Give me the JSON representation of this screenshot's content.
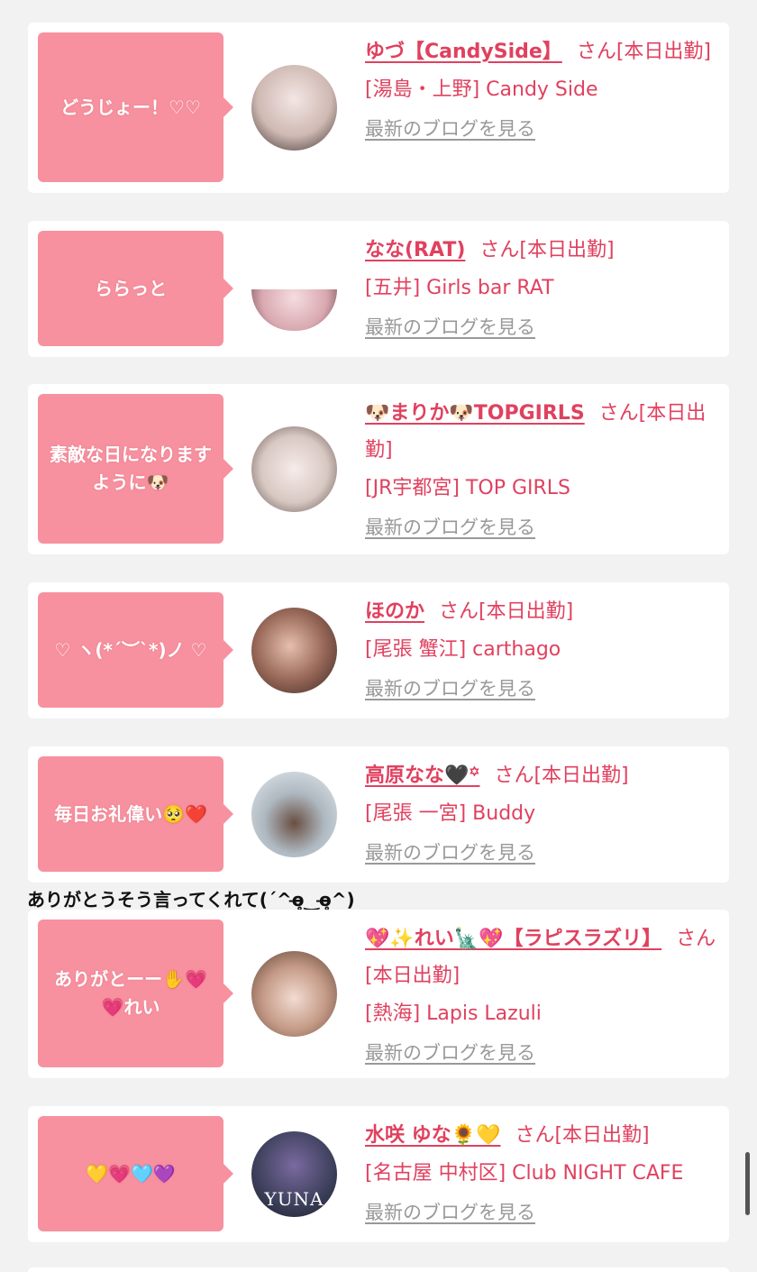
{
  "cards": [
    {
      "bubble": "どうじょー！♡♡",
      "name": "ゆづ【CandySide】",
      "suffix": "さん[本日出勤]",
      "shop": "[湯島・上野] Candy Side",
      "blog": "最新のブログを見る",
      "avatar_color": "#d9c9c4"
    },
    {
      "bubble": "ららっと",
      "name": "なな(RAT)",
      "suffix": "さん[本日出勤]",
      "shop": "[五井] Girls bar RAT",
      "blog": "最新のブログを見る",
      "avatar_color": "#e9c9cc"
    },
    {
      "bubble": "素敵な日になりますように🐶",
      "name": "🐶まりか🐶TOPGIRLS",
      "suffix": "さん[本日出勤]",
      "shop": "[JR宇都宮] TOP GIRLS",
      "blog": "最新のブログを見る",
      "avatar_color": "#e8ddd8"
    },
    {
      "bubble": "♡ ヽ(*´︶`*)ノ ♡",
      "name": "ほのか",
      "suffix": "さん[本日出勤]",
      "shop": "[尾張 蟹江] carthago",
      "blog": "最新のブログを見る",
      "avatar_color": "#8a5a4e"
    },
    {
      "bubble": "毎日お礼偉い🥺❤️",
      "name": "高原なな🖤꙳",
      "suffix": "さん[本日出勤]",
      "shop": "[尾張 一宮] Buddy",
      "blog": "最新のブログを見る",
      "avatar_color": "#b8c4cc"
    },
    {
      "bubble": "ありがとーー✋💗💗れい",
      "name": "💖✨れい🗽💖【ラピスラズリ】",
      "suffix": "さん[本日出勤]",
      "shop": "[熱海] Lapis Lazuli",
      "blog": "最新のブログを見る",
      "avatar_color": "#b59a8a"
    },
    {
      "bubble": "💛💗🩵💜",
      "name": "水咲 ゆな🌻💛",
      "suffix": "さん[本日出勤]",
      "shop": "[名古屋 中村区] Club NIGHT CAFE",
      "blog": "最新のブログを見る",
      "avatar_color": "#3c3f5a",
      "avatar_text": "YUNA"
    }
  ],
  "caption": "ありがとうそう言ってくれて(ˊ^ɵ̶̥̥‿ɵ̶̥̥^)",
  "colors": {
    "accent": "#e0415f",
    "bubble": "#f7919f",
    "link_gray": "#999999",
    "background": "#f2f2f2"
  }
}
